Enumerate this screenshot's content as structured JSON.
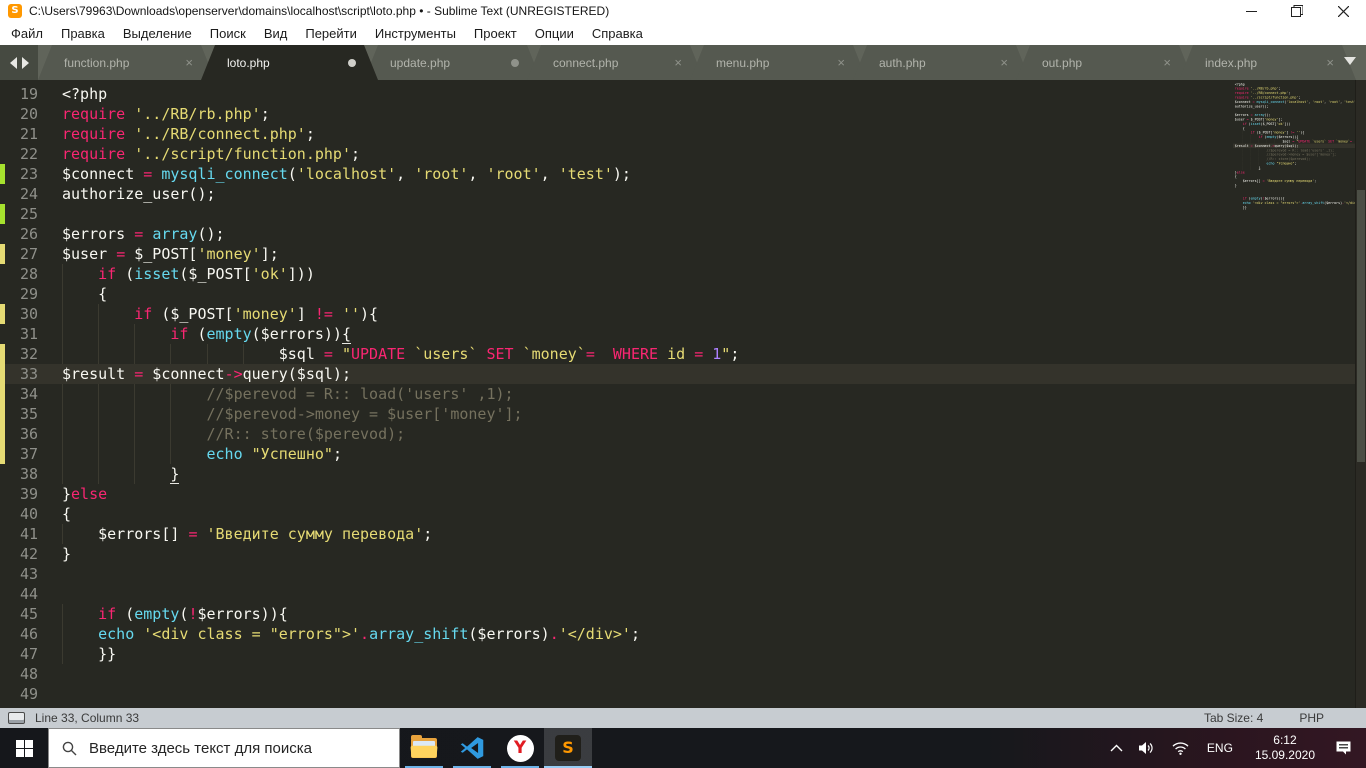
{
  "window": {
    "title": "C:\\Users\\79963\\Downloads\\openserver\\domains\\localhost\\script\\loto.php • - Sublime Text (UNREGISTERED)"
  },
  "menu": {
    "items": [
      "Файл",
      "Правка",
      "Выделение",
      "Поиск",
      "Вид",
      "Перейти",
      "Инструменты",
      "Проект",
      "Опции",
      "Справка"
    ]
  },
  "tabs": [
    {
      "label": "function.php",
      "modified": false,
      "active": false
    },
    {
      "label": "loto.php",
      "modified": true,
      "active": true
    },
    {
      "label": "update.php",
      "modified": true,
      "active": false
    },
    {
      "label": "connect.php",
      "modified": false,
      "active": false
    },
    {
      "label": "menu.php",
      "modified": false,
      "active": false
    },
    {
      "label": "auth.php",
      "modified": false,
      "active": false
    },
    {
      "label": "out.php",
      "modified": false,
      "active": false
    },
    {
      "label": "index.php",
      "modified": false,
      "active": false
    }
  ],
  "editor": {
    "current_line": 33,
    "lines": [
      {
        "n": 19,
        "m": "",
        "s": [
          [
            "<?php",
            "pln"
          ]
        ]
      },
      {
        "n": 20,
        "m": "",
        "s": [
          [
            "require",
            "kw"
          ],
          [
            " ",
            "pln"
          ],
          [
            "'../RB/rb.php'",
            "str"
          ],
          [
            ";",
            "pln"
          ]
        ]
      },
      {
        "n": 21,
        "m": "",
        "s": [
          [
            "require",
            "kw"
          ],
          [
            " ",
            "pln"
          ],
          [
            "'../RB/connect.php'",
            "str"
          ],
          [
            ";",
            "pln"
          ]
        ]
      },
      {
        "n": 22,
        "m": "",
        "s": [
          [
            "require",
            "kw"
          ],
          [
            " ",
            "pln"
          ],
          [
            "'../script/function.php'",
            "str"
          ],
          [
            ";",
            "pln"
          ]
        ]
      },
      {
        "n": 23,
        "m": "g",
        "s": [
          [
            "$connect ",
            "pln"
          ],
          [
            "=",
            "kw"
          ],
          [
            " ",
            "pln"
          ],
          [
            "mysqli_connect",
            "fn"
          ],
          [
            "(",
            "pln"
          ],
          [
            "'localhost'",
            "str"
          ],
          [
            ", ",
            "pln"
          ],
          [
            "'root'",
            "str"
          ],
          [
            ", ",
            "pln"
          ],
          [
            "'root'",
            "str"
          ],
          [
            ", ",
            "pln"
          ],
          [
            "'test'",
            "str"
          ],
          [
            ");",
            "pln"
          ]
        ]
      },
      {
        "n": 24,
        "m": "",
        "s": [
          [
            "authorize_user();",
            "pln"
          ]
        ]
      },
      {
        "n": 25,
        "m": "g",
        "s": []
      },
      {
        "n": 26,
        "m": "",
        "s": [
          [
            "$errors ",
            "pln"
          ],
          [
            "=",
            "kw"
          ],
          [
            " ",
            "pln"
          ],
          [
            "array",
            "fn"
          ],
          [
            "();",
            "pln"
          ]
        ]
      },
      {
        "n": 27,
        "m": "y",
        "s": [
          [
            "$user ",
            "pln"
          ],
          [
            "=",
            "kw"
          ],
          [
            " $_POST[",
            "pln"
          ],
          [
            "'money'",
            "str"
          ],
          [
            "];",
            "pln"
          ]
        ]
      },
      {
        "n": 28,
        "m": "",
        "s": [
          [
            "    ",
            "ind"
          ],
          [
            "if",
            "kw"
          ],
          [
            " (",
            "pln"
          ],
          [
            "isset",
            "fn"
          ],
          [
            "($_POST[",
            "pln"
          ],
          [
            "'ok'",
            "str"
          ],
          [
            "]))",
            "pln"
          ]
        ]
      },
      {
        "n": 29,
        "m": "",
        "s": [
          [
            "    ",
            "ind"
          ],
          [
            "{",
            "pln"
          ]
        ]
      },
      {
        "n": 30,
        "m": "y",
        "s": [
          [
            "    ",
            "ind"
          ],
          [
            "    ",
            "ind"
          ],
          [
            "if",
            "kw"
          ],
          [
            " ($_POST[",
            "pln"
          ],
          [
            "'money'",
            "str"
          ],
          [
            "] ",
            "pln"
          ],
          [
            "!=",
            "kw"
          ],
          [
            " ",
            "pln"
          ],
          [
            "''",
            "str"
          ],
          [
            "){",
            "pln"
          ]
        ]
      },
      {
        "n": 31,
        "m": "",
        "s": [
          [
            "    ",
            "ind"
          ],
          [
            "    ",
            "ind"
          ],
          [
            "    ",
            "ind"
          ],
          [
            "if",
            "kw"
          ],
          [
            " (",
            "pln"
          ],
          [
            "empty",
            "fn"
          ],
          [
            "($errors))",
            "pln"
          ],
          [
            "{",
            "pln u"
          ]
        ]
      },
      {
        "n": 32,
        "m": "y",
        "s": [
          [
            "    ",
            "ind"
          ],
          [
            "    ",
            "ind"
          ],
          [
            "    ",
            "ind"
          ],
          [
            "    ",
            "ind"
          ],
          [
            "    ",
            "ind"
          ],
          [
            "    ",
            "ind"
          ],
          [
            "$sql ",
            "pln"
          ],
          [
            "=",
            "kw"
          ],
          [
            " ",
            "pln"
          ],
          [
            "\"",
            "str"
          ],
          [
            "UPDATE",
            "kw"
          ],
          [
            " `users` ",
            "str"
          ],
          [
            "SET",
            "kw"
          ],
          [
            " `money`",
            "str"
          ],
          [
            "=",
            "kw"
          ],
          [
            "  ",
            "str"
          ],
          [
            "WHERE",
            "kw"
          ],
          [
            " id ",
            "str"
          ],
          [
            "=",
            "kw"
          ],
          [
            " ",
            "str"
          ],
          [
            "1",
            "num"
          ],
          [
            "\"",
            "str"
          ],
          [
            ";",
            "pln"
          ]
        ]
      },
      {
        "n": 33,
        "m": "y",
        "s": [
          [
            "$result ",
            "pln"
          ],
          [
            "=",
            "kw"
          ],
          [
            " $connect",
            "pln"
          ],
          [
            "->",
            "kw"
          ],
          [
            "query($sql);",
            "pln"
          ]
        ]
      },
      {
        "n": 34,
        "m": "y",
        "s": [
          [
            "    ",
            "ind"
          ],
          [
            "    ",
            "ind"
          ],
          [
            "    ",
            "ind"
          ],
          [
            "    ",
            "ind"
          ],
          [
            "//$perevod = R:: load('users' ,1);",
            "com"
          ]
        ]
      },
      {
        "n": 35,
        "m": "y",
        "s": [
          [
            "    ",
            "ind"
          ],
          [
            "    ",
            "ind"
          ],
          [
            "    ",
            "ind"
          ],
          [
            "    ",
            "ind"
          ],
          [
            "//$perevod->money = $user['money'];",
            "com"
          ]
        ]
      },
      {
        "n": 36,
        "m": "y",
        "s": [
          [
            "    ",
            "ind"
          ],
          [
            "    ",
            "ind"
          ],
          [
            "    ",
            "ind"
          ],
          [
            "    ",
            "ind"
          ],
          [
            "//R:: store($perevod);",
            "com"
          ]
        ]
      },
      {
        "n": 37,
        "m": "y",
        "s": [
          [
            "    ",
            "ind"
          ],
          [
            "    ",
            "ind"
          ],
          [
            "    ",
            "ind"
          ],
          [
            "    ",
            "ind"
          ],
          [
            "echo",
            "fn"
          ],
          [
            " ",
            "pln"
          ],
          [
            "\"Успешно\"",
            "str"
          ],
          [
            ";",
            "pln"
          ]
        ]
      },
      {
        "n": 38,
        "m": "",
        "s": [
          [
            "    ",
            "ind"
          ],
          [
            "    ",
            "ind"
          ],
          [
            "    ",
            "ind"
          ],
          [
            "}",
            "pln u"
          ]
        ]
      },
      {
        "n": 39,
        "m": "",
        "s": [
          [
            "}",
            "pln"
          ],
          [
            "else",
            "kw"
          ]
        ]
      },
      {
        "n": 40,
        "m": "",
        "s": [
          [
            "{",
            "pln"
          ]
        ]
      },
      {
        "n": 41,
        "m": "",
        "s": [
          [
            "    ",
            "ind"
          ],
          [
            "$errors[] ",
            "pln"
          ],
          [
            "=",
            "kw"
          ],
          [
            " ",
            "pln"
          ],
          [
            "'Введите сумму перевода'",
            "str"
          ],
          [
            ";",
            "pln"
          ]
        ]
      },
      {
        "n": 42,
        "m": "",
        "s": [
          [
            "}",
            "pln"
          ]
        ]
      },
      {
        "n": 43,
        "m": "",
        "s": []
      },
      {
        "n": 44,
        "m": "",
        "s": []
      },
      {
        "n": 45,
        "m": "",
        "s": [
          [
            "    ",
            "ind"
          ],
          [
            "if",
            "kw"
          ],
          [
            " (",
            "pln"
          ],
          [
            "empty",
            "fn"
          ],
          [
            "(",
            "pln"
          ],
          [
            "!",
            "kw"
          ],
          [
            "$errors))",
            "pln"
          ],
          [
            "{",
            "pln"
          ]
        ]
      },
      {
        "n": 46,
        "m": "",
        "s": [
          [
            "    ",
            "ind"
          ],
          [
            "echo",
            "fn"
          ],
          [
            " ",
            "pln"
          ],
          [
            "'<div class = \"errors\">'",
            "str"
          ],
          [
            ".",
            "kw"
          ],
          [
            "array_shift",
            "fn"
          ],
          [
            "($errors)",
            "pln"
          ],
          [
            ".",
            "kw"
          ],
          [
            "'</div>'",
            "str"
          ],
          [
            ";",
            "pln"
          ]
        ]
      },
      {
        "n": 47,
        "m": "",
        "s": [
          [
            "    ",
            "ind"
          ],
          [
            "}}",
            "pln"
          ]
        ]
      },
      {
        "n": 48,
        "m": "",
        "s": []
      },
      {
        "n": 49,
        "m": "",
        "s": []
      }
    ]
  },
  "status": {
    "position": "Line 33, Column 33",
    "tab_size": "Tab Size: 4",
    "syntax": "PHP"
  },
  "taskbar": {
    "search_placeholder": "Введите здесь текст для поиска",
    "apps": [
      "file-explorer",
      "vscode",
      "yandex-browser",
      "sublime-text"
    ],
    "tray": {
      "language": "ENG",
      "time": "6:12",
      "date": "15.09.2020"
    }
  },
  "colors": {
    "editor_bg": "#272822",
    "keyword": "#f92672",
    "function": "#66d9ef",
    "string": "#e6db74",
    "number": "#ae81ff",
    "comment": "#75715e",
    "diff_added": "#a6e22e",
    "diff_modified": "#e5db74",
    "taskbar_accent": "#6db3e8"
  }
}
